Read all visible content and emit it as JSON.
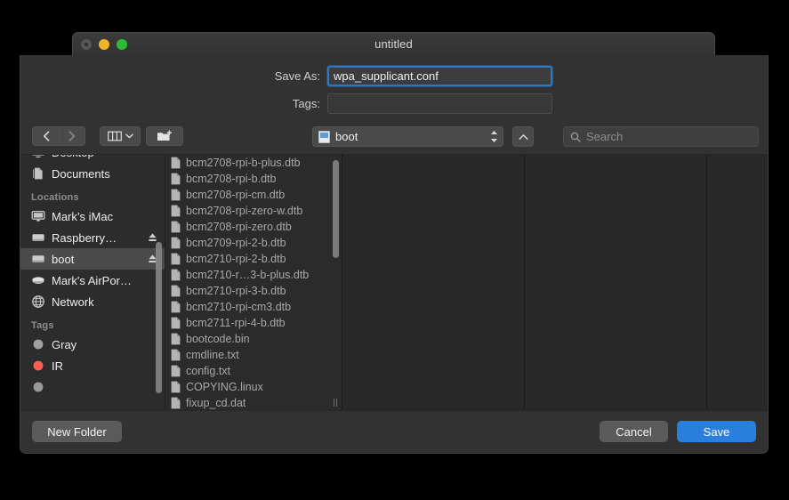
{
  "window": {
    "title": "untitled",
    "traffic_lights": [
      "close",
      "minimize",
      "maximize"
    ]
  },
  "form": {
    "name_label": "Save As:",
    "name_value": "wpa_supplicant.conf",
    "tags_label": "Tags:",
    "tags_value": "",
    "tags_placeholder": ""
  },
  "toolbar": {
    "back_icon": "chevron-left-icon",
    "forward_icon": "chevron-right-icon",
    "view_icon": "column-view-icon",
    "view_chevron_icon": "chevron-down-icon",
    "new_folder_icon": "new-folder-icon",
    "path_label": "boot",
    "path_icon": "removable-disk-icon",
    "stepper_icon": "up-down-stepper-icon",
    "up_icon": "chevron-up-icon",
    "search_placeholder": "Search",
    "search_value": "",
    "search_icon": "search-icon"
  },
  "sidebar": {
    "groups": [
      {
        "header": "",
        "items": [
          {
            "label": "Desktop",
            "icon": "desktop-icon",
            "eject": false,
            "selected": false,
            "clipped": true
          },
          {
            "label": "Documents",
            "icon": "documents-icon",
            "eject": false,
            "selected": false,
            "clipped": false
          }
        ]
      },
      {
        "header": "Locations",
        "items": [
          {
            "label": "Mark’s iMac",
            "icon": "imac-icon",
            "eject": false,
            "selected": false,
            "clipped": false
          },
          {
            "label": "Raspberry…",
            "icon": "drive-icon",
            "eject": true,
            "selected": false,
            "clipped": false
          },
          {
            "label": "boot",
            "icon": "drive-icon",
            "eject": true,
            "selected": true,
            "clipped": false
          },
          {
            "label": "Mark's AirPor…",
            "icon": "airport-icon",
            "eject": false,
            "selected": false,
            "clipped": false
          },
          {
            "label": "Network",
            "icon": "network-globe-icon",
            "eject": false,
            "selected": false,
            "clipped": false
          }
        ]
      },
      {
        "header": "Tags",
        "items": [
          {
            "label": "Gray",
            "icon": "tag-dot-icon",
            "color": "#a0a0a0",
            "eject": false,
            "selected": false,
            "clipped": false
          },
          {
            "label": "IR",
            "icon": "tag-dot-icon",
            "color": "#ff5f52",
            "eject": false,
            "selected": false,
            "clipped": false
          },
          {
            "label": "",
            "icon": "tag-dot-icon",
            "color": "#9a9a9a",
            "eject": false,
            "selected": false,
            "clipped": true
          }
        ]
      }
    ]
  },
  "files": {
    "items": [
      "bcm2708-rpi-b-plus.dtb",
      "bcm2708-rpi-b.dtb",
      "bcm2708-rpi-cm.dtb",
      "bcm2708-rpi-zero-w.dtb",
      "bcm2708-rpi-zero.dtb",
      "bcm2709-rpi-2-b.dtb",
      "bcm2710-rpi-2-b.dtb",
      "bcm2710-r…3-b-plus.dtb",
      "bcm2710-rpi-3-b.dtb",
      "bcm2710-rpi-cm3.dtb",
      "bcm2711-rpi-4-b.dtb",
      "bootcode.bin",
      "cmdline.txt",
      "config.txt",
      "COPYING.linux",
      "fixup_cd.dat"
    ]
  },
  "footer": {
    "new_folder_label": "New Folder",
    "cancel_label": "Cancel",
    "save_label": "Save"
  },
  "colors": {
    "accent": "#2a7fdd",
    "focus_ring": "#2a79c4",
    "selection": "#4b4b4b"
  }
}
